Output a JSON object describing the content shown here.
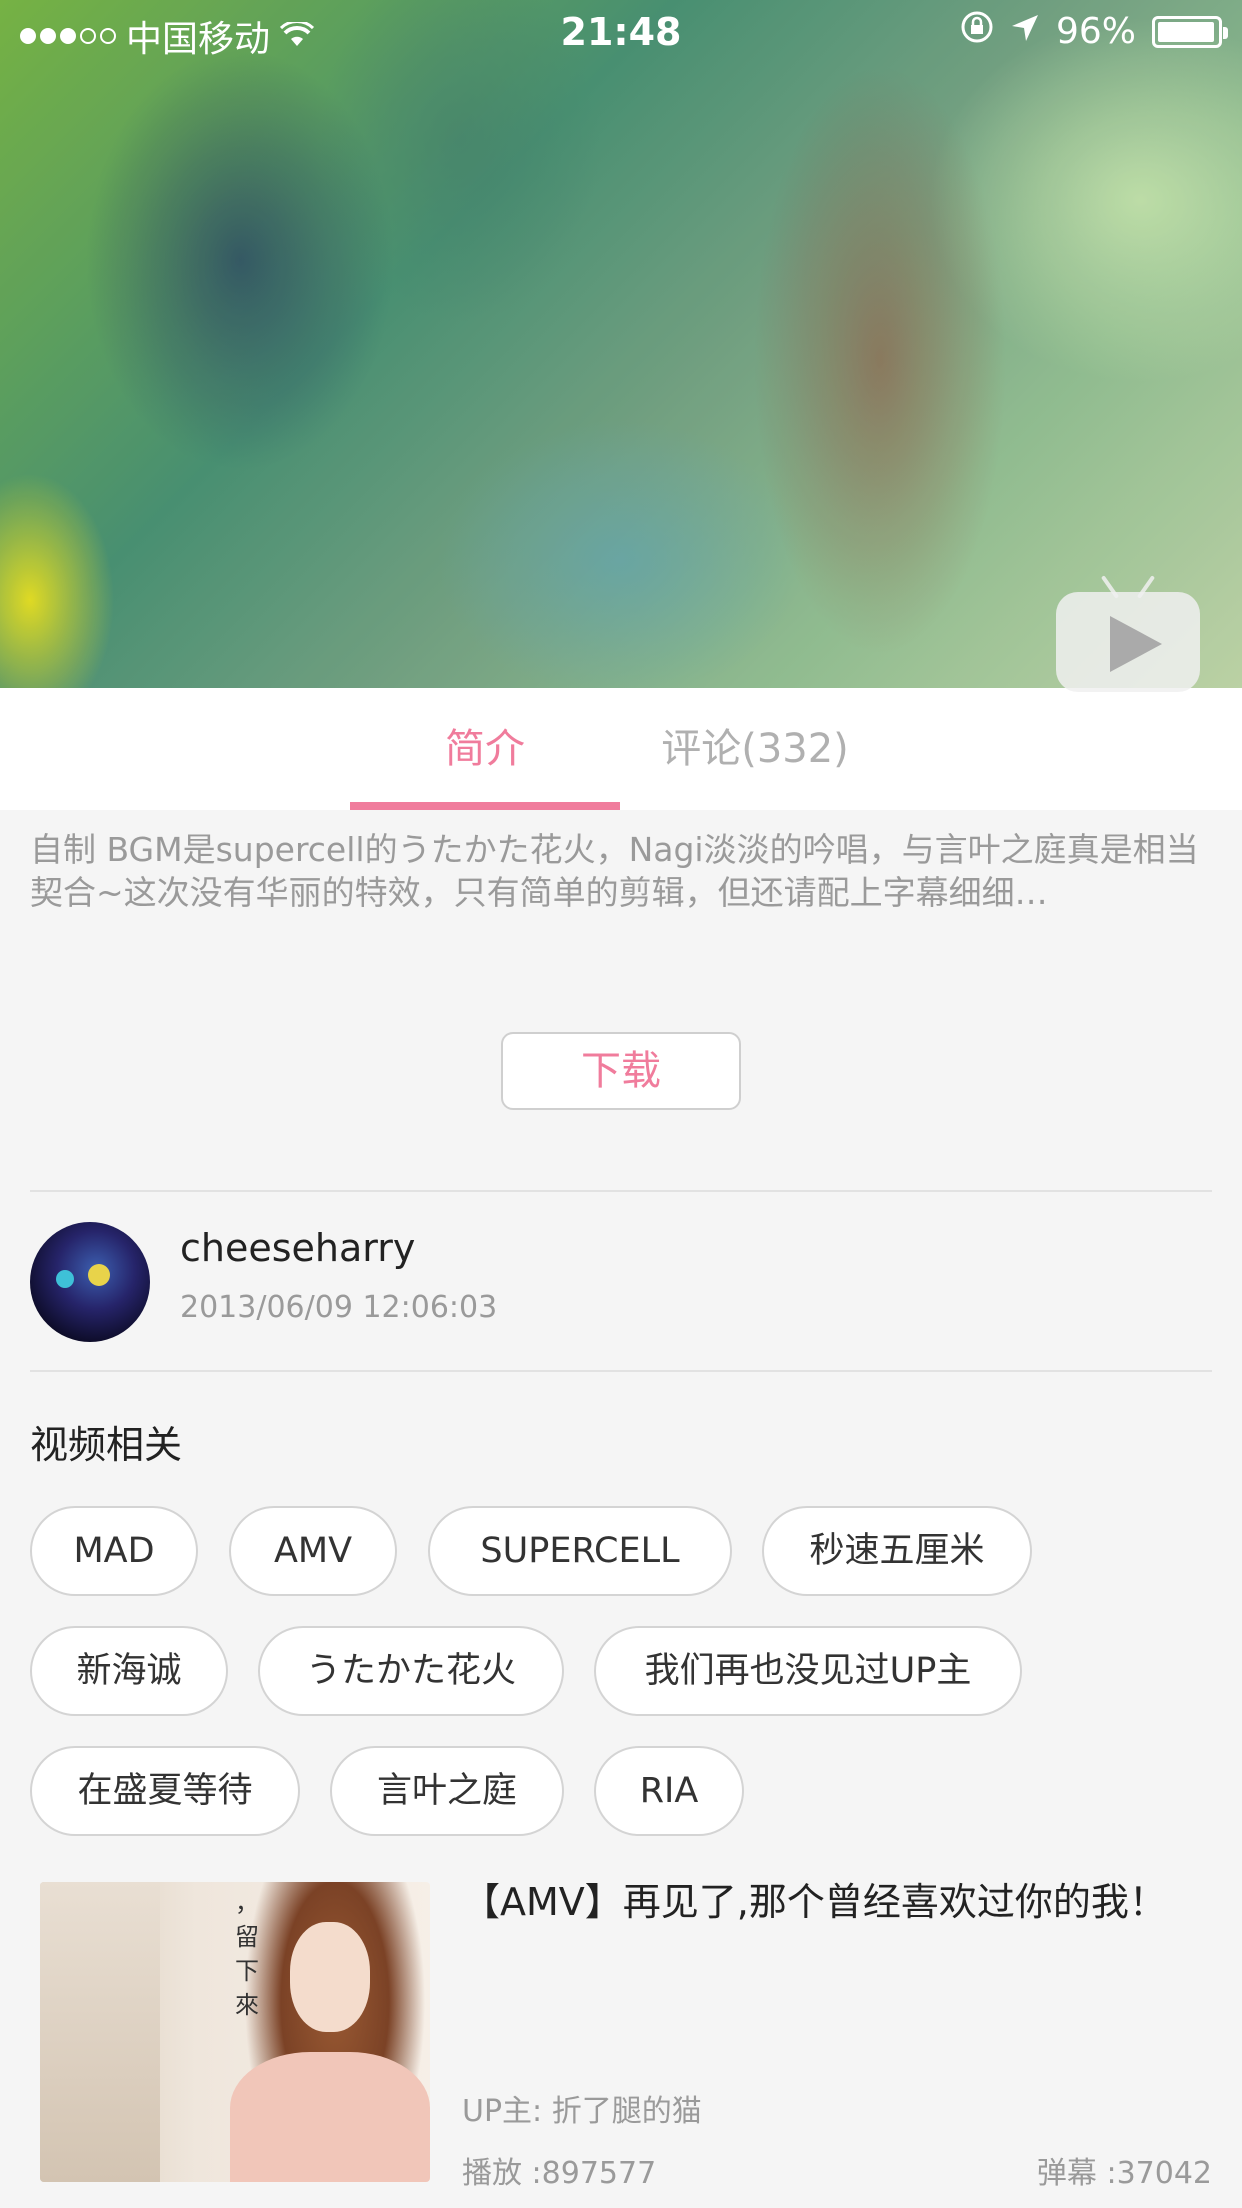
{
  "status_bar": {
    "carrier": "中国移动",
    "time": "21:48",
    "battery": "96%",
    "battery_level": 0.96,
    "signal_dots_filled": 3,
    "signal_dots_total": 5
  },
  "tabs": [
    {
      "label": "简介",
      "active": true
    },
    {
      "label": "评论(332)",
      "active": false
    }
  ],
  "description": "自制 BGM是supercell的うたかた花火，Nagi淡淡的吟唱，与言叶之庭真是相当契合~这次没有华丽的特效，只有简单的剪辑，但还请配上字幕细细…",
  "download_label": "下载",
  "uploader": {
    "name": "cheeseharry",
    "time": "2013/06/09 12:06:03"
  },
  "related_section_title": "视频相关",
  "tags": [
    "MAD",
    "AMV",
    "SUPERCELL",
    "秒速五厘米",
    "新海诚",
    "うたかた花火",
    "我们再也没见过UP主",
    "在盛夏等待",
    "言叶之庭",
    "RIA"
  ],
  "related_video": {
    "title": "【AMV】再见了,那个曾经喜欢过你的我！",
    "thumb_text": "，留下來",
    "up": "UP主: 折了腿的猫",
    "plays": "播放 :897577",
    "danmu": "弹幕 :37042"
  },
  "colors": {
    "accent": "#f07c9c",
    "muted_text": "#9a9a9a",
    "background": "#f5f5f5"
  },
  "icons": {
    "wifi": "wifi-icon",
    "lock_rotation": "rotation-lock-icon",
    "location": "location-arrow-icon",
    "play": "tv-play-icon"
  }
}
